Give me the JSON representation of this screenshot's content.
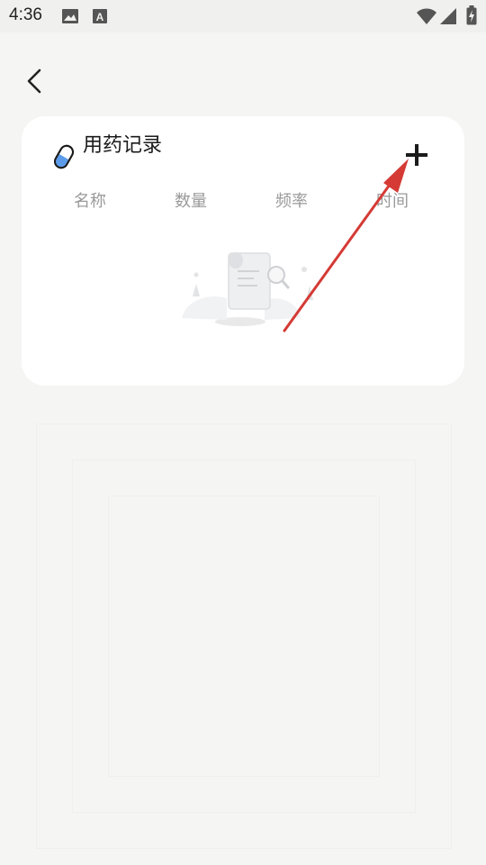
{
  "status_bar": {
    "time": "4:36",
    "icons": [
      "image-icon",
      "a-icon",
      "wifi-icon",
      "signal-icon",
      "battery-icon"
    ]
  },
  "nav": {
    "back_icon": "chevron-left-icon"
  },
  "card": {
    "title": "用药记录",
    "title_icon": "pill-icon",
    "add_icon": "plus-icon",
    "columns": [
      "名称",
      "数量",
      "频率",
      "时间"
    ],
    "empty_illustration": "empty-document-icon"
  },
  "annotation": {
    "color": "#d53a35",
    "icon": "arrow-pointer"
  },
  "colors": {
    "background": "#f5f5f4",
    "card": "#ffffff",
    "pill_blue": "#5b9bea"
  }
}
